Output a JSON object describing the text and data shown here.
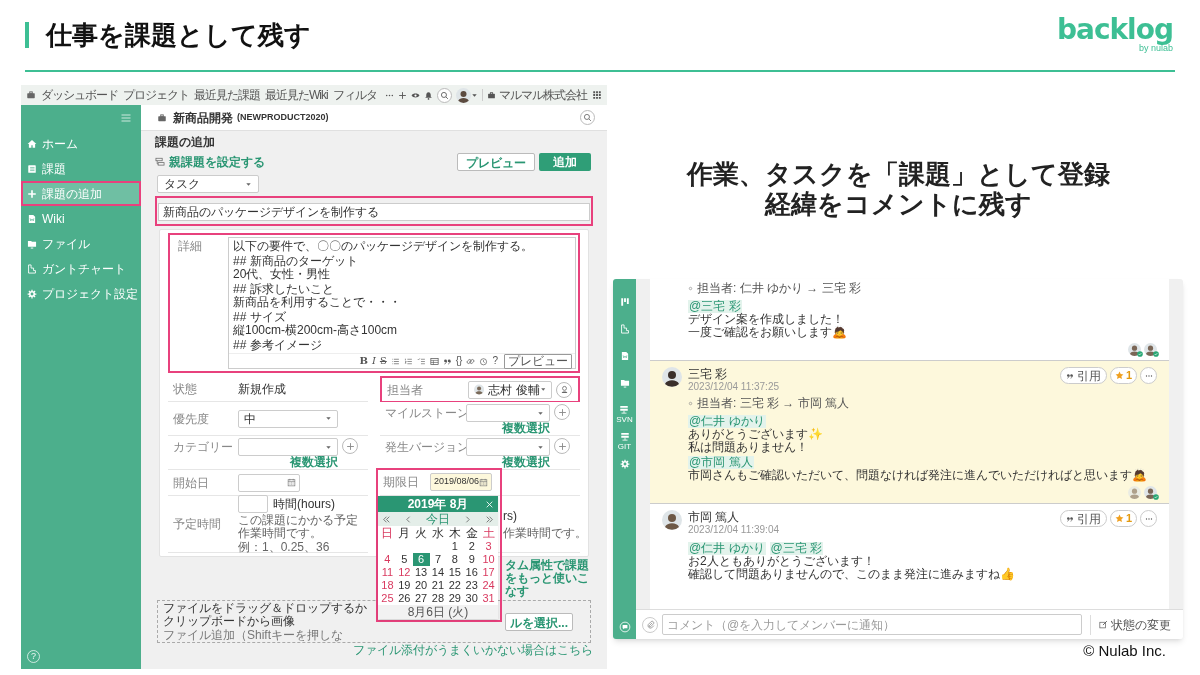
{
  "slide": {
    "title": "仕事を課題として残す",
    "logo": "backlog",
    "logo_byline": "by nulab",
    "headline_lines": [
      "作業、タスクを「課題」として登録",
      "経緯をコメントに残す"
    ],
    "copyright": "© Nulab Inc."
  },
  "issue_screen": {
    "top_nav": [
      "ダッシュボード",
      "プロジェクト",
      "最近見た課題",
      "最近見たWiki",
      "フィルタ"
    ],
    "organization": "マルマル株式会社",
    "sidebar": [
      {
        "label": "ホーム",
        "selected": false,
        "highlighted": false
      },
      {
        "label": "課題",
        "selected": false,
        "highlighted": false
      },
      {
        "label": "課題の追加",
        "selected": true,
        "highlighted": true
      },
      {
        "label": "Wiki",
        "selected": false,
        "highlighted": false
      },
      {
        "label": "ファイル",
        "selected": false,
        "highlighted": false
      },
      {
        "label": "ガントチャート",
        "selected": false,
        "highlighted": false
      },
      {
        "label": "プロジェクト設定",
        "selected": false,
        "highlighted": false
      }
    ],
    "help": "?",
    "project": {
      "name": "新商品開発",
      "key": "(NEWPRODUCT2020)"
    },
    "page_title": "課題の追加",
    "parent_link": "親課題を設定する",
    "buttons": {
      "preview": "プレビュー",
      "submit": "追加"
    },
    "issue_type": "タスク",
    "subject": {
      "value": "新商品のパッケージデザインを制作する",
      "highlighted": true
    },
    "description": {
      "label": "詳細",
      "highlighted": true,
      "blocks": [
        [
          "以下の要件で、〇〇のパッケージデザインを制作する。"
        ],
        [
          "## 新商品のターゲット",
          "20代、女性・男性"
        ],
        [
          "## 訴求したいこと",
          "新商品を利用することで・・・"
        ],
        [
          "## サイズ",
          "縦100cm-横200cm-高さ100cm"
        ],
        [
          "## 参考イメージ"
        ]
      ]
    },
    "toolbar": {
      "glyphs": [
        "B",
        "I",
        "S"
      ],
      "braces": "{}",
      "help": "?",
      "preview": "プレビュー"
    },
    "left_fields": [
      {
        "kind": "text",
        "label": "状態",
        "value": "新規作成",
        "highlighted": false
      },
      {
        "kind": "select",
        "label": "優先度",
        "value": "中",
        "add": false,
        "highlighted": false
      },
      {
        "kind": "select",
        "label": "カテゴリー",
        "add": true,
        "multi": "複数選択",
        "highlighted": false
      },
      {
        "kind": "date",
        "label": "開始日",
        "focused": false,
        "highlighted": false
      },
      {
        "kind": "hours",
        "label": "予定時間",
        "unit": "時間(hours)",
        "hint_lines": [
          "この課題にかかる予定作業時間です。",
          "例：1、0.25、36"
        ],
        "highlighted": false
      }
    ],
    "right_fields": [
      {
        "kind": "assignee",
        "label": "担当者",
        "value": "志村 俊輔",
        "highlighted": true
      },
      {
        "kind": "select",
        "label": "マイルストーン",
        "add": true,
        "multi": "複数選択",
        "highlighted": false
      },
      {
        "kind": "select",
        "label": "発生バージョン",
        "add": true,
        "multi": "複数選択",
        "highlighted": false
      },
      {
        "kind": "date",
        "label": "期限日",
        "value": "2019/08/06",
        "focused": true,
        "highlighted": true,
        "calendar": {
          "title": "2019年 8月",
          "today": "今日",
          "weekdays": [
            {
              "label": "日",
              "holiday": true
            },
            {
              "label": "月",
              "holiday": false
            },
            {
              "label": "火",
              "holiday": false
            },
            {
              "label": "水",
              "holiday": false
            },
            {
              "label": "木",
              "holiday": false
            },
            {
              "label": "金",
              "holiday": false
            },
            {
              "label": "土",
              "holiday": true
            }
          ],
          "weeks": [
            [
              {
                "d": "1",
                "selected": false,
                "holiday": false
              },
              {
                "d": "2",
                "selected": false,
                "holiday": false
              },
              {
                "d": "3",
                "selected": false,
                "holiday": true
              }
            ],
            [
              {
                "d": "4",
                "selected": false,
                "holiday": true
              },
              {
                "d": "5",
                "selected": false,
                "holiday": false
              },
              {
                "d": "6",
                "selected": true,
                "holiday": false
              },
              {
                "d": "7",
                "selected": false,
                "holiday": false
              },
              {
                "d": "8",
                "selected": false,
                "holiday": false
              },
              {
                "d": "9",
                "selected": false,
                "holiday": false
              },
              {
                "d": "10",
                "selected": false,
                "holiday": true
              }
            ],
            [
              {
                "d": "11",
                "selected": false,
                "holiday": true
              },
              {
                "d": "12",
                "selected": false,
                "holiday": true
              },
              {
                "d": "13",
                "selected": false,
                "holiday": false
              },
              {
                "d": "14",
                "selected": false,
                "holiday": false
              },
              {
                "d": "15",
                "selected": false,
                "holiday": false
              },
              {
                "d": "16",
                "selected": false,
                "holiday": false
              },
              {
                "d": "17",
                "selected": false,
                "holiday": true
              }
            ],
            [
              {
                "d": "18",
                "selected": false,
                "holiday": true
              },
              {
                "d": "19",
                "selected": false,
                "holiday": false
              },
              {
                "d": "20",
                "selected": false,
                "holiday": false
              },
              {
                "d": "21",
                "selected": false,
                "holiday": false
              },
              {
                "d": "22",
                "selected": false,
                "holiday": false
              },
              {
                "d": "23",
                "selected": false,
                "holiday": false
              },
              {
                "d": "24",
                "selected": false,
                "holiday": true
              }
            ],
            [
              {
                "d": "25",
                "selected": false,
                "holiday": true
              },
              {
                "d": "26",
                "selected": false,
                "holiday": false
              },
              {
                "d": "27",
                "selected": false,
                "holiday": false
              },
              {
                "d": "28",
                "selected": false,
                "holiday": false
              },
              {
                "d": "29",
                "selected": false,
                "holiday": false
              },
              {
                "d": "30",
                "selected": false,
                "holiday": false
              },
              {
                "d": "31",
                "selected": false,
                "holiday": true
              }
            ]
          ],
          "footer": "8月6日 (火)"
        }
      },
      {
        "kind": "hours_partial",
        "unit": "rs)",
        "hint": "作業時間です。",
        "highlighted": false
      }
    ],
    "custom_link": "タム属性で課題をもっと使いこなす",
    "dropzone": {
      "text": "ファイルをドラッグ＆ドロップするかクリップボードから画像",
      "button": "ルを選択...",
      "hint": "ファイル追加（Shiftキーを押しな"
    },
    "attach_help": "ファイル添付がうまくいかない場合はこちら"
  },
  "comment_screen": {
    "rail_captions": [
      "SVN",
      "GIT"
    ],
    "comments": [
      {
        "highlighted": false,
        "blocks": [
          {
            "kind": "change",
            "text": "担当者: 仁井 ゆかり → 三宅 彩"
          },
          {
            "kind": "mention",
            "names": [
              "@三宅 彩"
            ]
          },
          {
            "kind": "text",
            "lines": [
              "デザイン案を作成しました！",
              "一度ご確認をお願いします🙇"
            ]
          }
        ],
        "readers": [
          {
            "checked": true
          },
          {
            "checked": true
          }
        ]
      },
      {
        "highlighted": true,
        "author": "三宅 彩",
        "date": "2023/12/04 11:37:25",
        "quote": "引用",
        "star_count": "1",
        "blocks": [
          {
            "kind": "change",
            "text": "担当者: 三宅 彩 → 市岡 篤人"
          },
          {
            "kind": "mention",
            "names": [
              "@仁井 ゆかり"
            ]
          },
          {
            "kind": "text",
            "lines": [
              "ありがとうございます✨",
              "私は問題ありません！"
            ]
          },
          {
            "kind": "mention",
            "names": [
              "@市岡 篤人"
            ]
          },
          {
            "kind": "text",
            "lines": [
              "市岡さんもご確認いただいて、問題なければ発注に進んでいただければと思います🙇"
            ]
          }
        ],
        "readers": [
          {
            "checked": false
          },
          {
            "checked": true
          }
        ]
      },
      {
        "highlighted": false,
        "author": "市岡 篤人",
        "date": "2023/12/04 11:39:04",
        "quote": "引用",
        "star_count": "1",
        "blocks": [
          {
            "kind": "mention",
            "names": [
              "@仁井 ゆかり",
              "@三宅 彩"
            ]
          },
          {
            "kind": "text",
            "lines": [
              "お2人ともありがとうございます！",
              "確認して問題ありませんので、このまま発注に進みますね👍"
            ]
          }
        ]
      }
    ],
    "comment_box": {
      "placeholder": "コメント（@を入力してメンバーに通知）"
    },
    "status_button": "状態の変更"
  }
}
